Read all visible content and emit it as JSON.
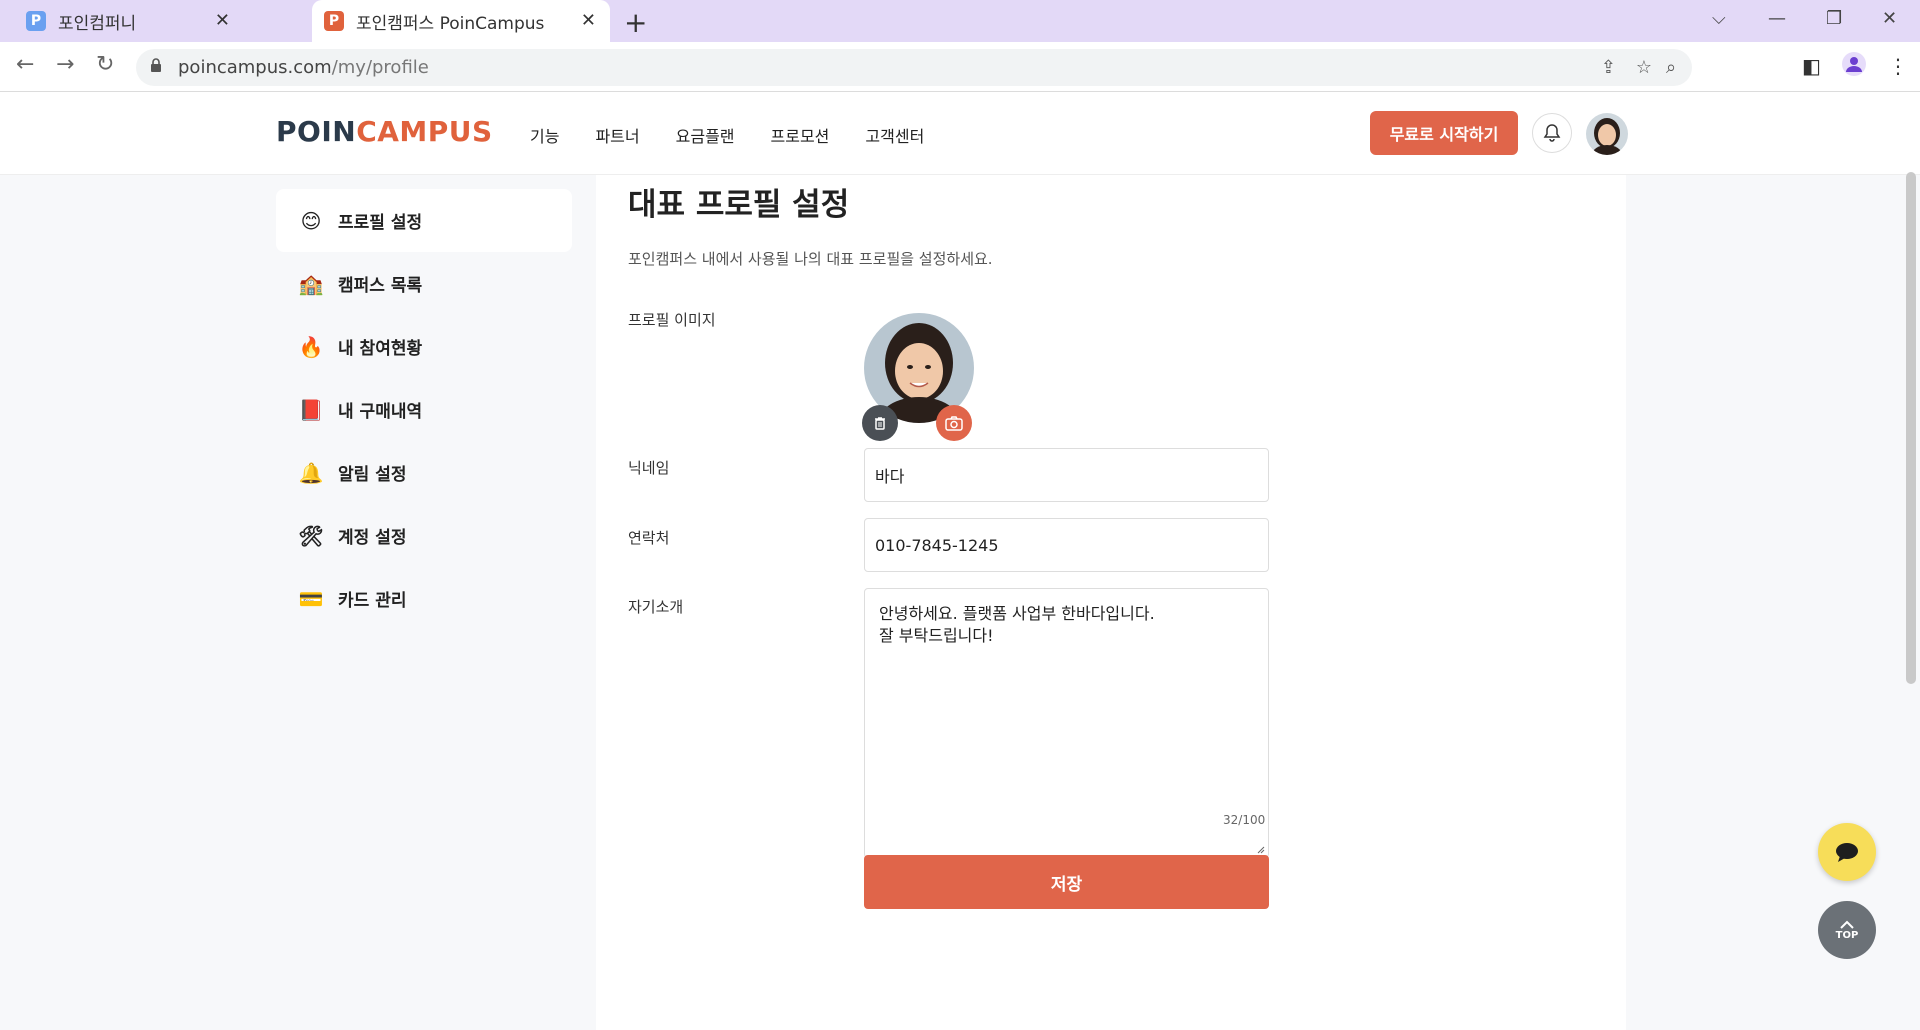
{
  "browser": {
    "tabs": [
      {
        "label": "포인컴퍼니",
        "favicon": "P",
        "favicon_color": "#6aa0f0"
      },
      {
        "label": "포인캠퍼스 PoinCampus",
        "favicon": "P",
        "favicon_color": "#e0623c"
      }
    ],
    "url_domain": "poincampus.com",
    "url_path": "/my/profile"
  },
  "header": {
    "logo_part1": "POIN",
    "logo_part2": "CAMPUS",
    "nav": [
      "기능",
      "파트너",
      "요금플랜",
      "프로모션",
      "고객센터"
    ],
    "cta_label": "무료로 시작하기"
  },
  "sidebar": {
    "items": [
      {
        "icon": "😊",
        "icon_name": "smile-icon",
        "label": "프로필 설정",
        "active": true
      },
      {
        "icon": "🏫",
        "icon_name": "school-icon",
        "label": "캠퍼스 목록"
      },
      {
        "icon": "🔥",
        "icon_name": "fire-icon",
        "label": "내 참여현황"
      },
      {
        "icon": "📕",
        "icon_name": "book-icon",
        "label": "내 구매내역"
      },
      {
        "icon": "🔔",
        "icon_name": "bell-icon",
        "label": "알림 설정"
      },
      {
        "icon": "🛠",
        "icon_name": "tools-icon",
        "label": "계정 설정"
      },
      {
        "icon": "💳",
        "icon_name": "card-icon",
        "label": "카드 관리"
      }
    ]
  },
  "profile": {
    "title": "대표 프로필 설정",
    "description": "포인캠퍼스 내에서 사용될 나의 대표 프로필을 설정하세요.",
    "image_label": "프로필 이미지",
    "nickname_label": "닉네임",
    "nickname_value": "바다",
    "phone_label": "연락처",
    "phone_value": "010-7845-1245",
    "intro_label": "자기소개",
    "intro_line1": "안녕하세요. 플랫폼 사업부 한바다입니다.",
    "intro_line2": "잘 부탁드립니다!",
    "intro_counter": "32/100",
    "save_label": "저장"
  },
  "floating": {
    "top_label": "TOP"
  },
  "colors": {
    "accent": "#e0654a",
    "chat_fab": "#f7dd59",
    "tabbar": "#e3d9f7"
  }
}
